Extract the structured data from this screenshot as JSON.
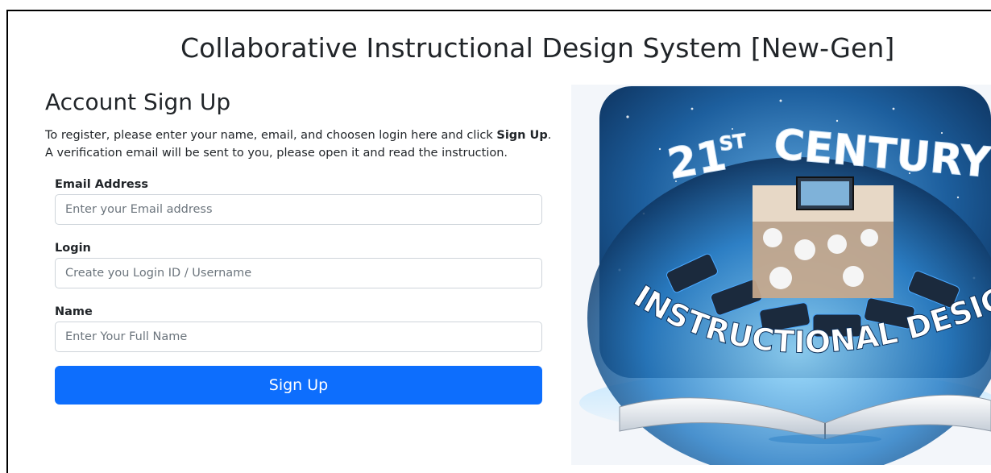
{
  "site": {
    "title": "Collaborative Instructional Design System [New-Gen]"
  },
  "form": {
    "heading": "Account Sign Up",
    "intro_line1_prefix": "To register, please enter your name, email, and choosen login here and click ",
    "intro_line1_bold": "Sign Up",
    "intro_line1_suffix": ".",
    "intro_line2": "A verification email will be sent to you, please open it and read the instruction.",
    "fields": [
      {
        "label": "Email Address",
        "placeholder": "Enter your Email address",
        "value": ""
      },
      {
        "label": "Login",
        "placeholder": "Create you Login ID / Username",
        "value": ""
      },
      {
        "label": "Name",
        "placeholder": "Enter Your Full Name",
        "value": ""
      }
    ],
    "submit_label": "Sign Up"
  },
  "hero": {
    "text_top_num": "21",
    "text_top_sup": "ST",
    "text_top_word": "CENTURY",
    "text_bottom": "INSTRUCTIONAL DESIGN"
  },
  "colors": {
    "primary": "#0d6efd",
    "text": "#212529",
    "placeholder": "#6c757d",
    "border": "#ced4da"
  }
}
